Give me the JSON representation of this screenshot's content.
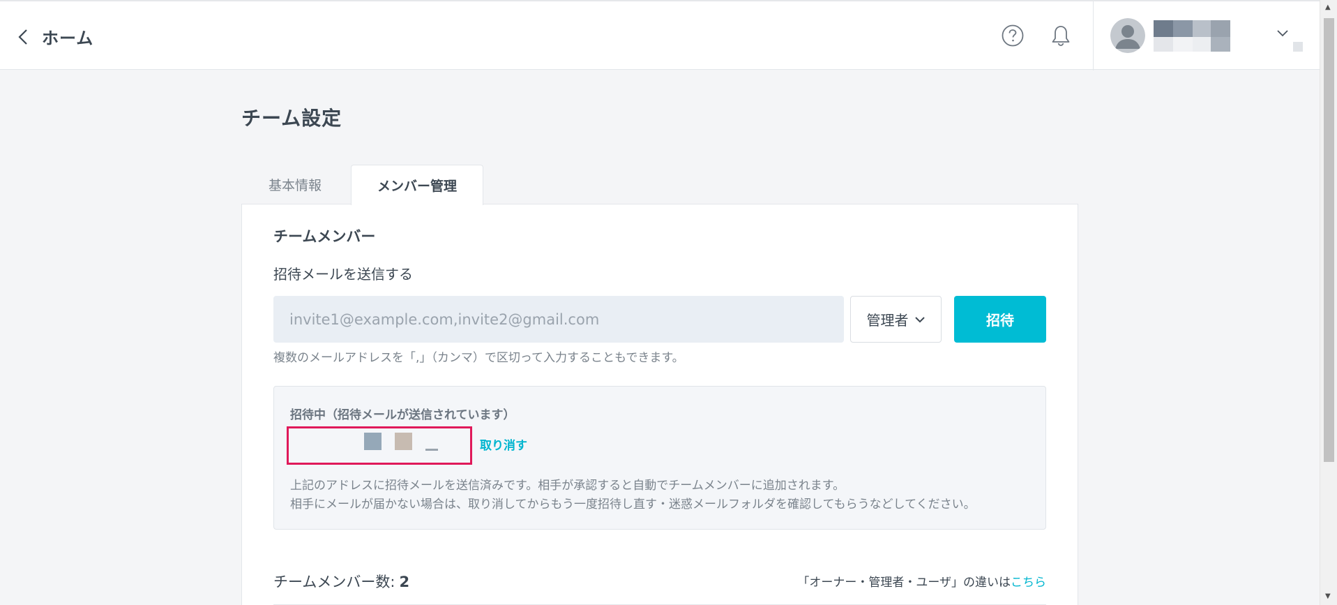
{
  "header": {
    "back_label": "ホーム",
    "icons": [
      "chevron-left-icon",
      "help-icon",
      "bell-icon",
      "chevron-down-icon"
    ]
  },
  "page": {
    "title": "チーム設定"
  },
  "tabs": [
    {
      "label": "基本情報",
      "active": false
    },
    {
      "label": "メンバー管理",
      "active": true
    }
  ],
  "members_section": {
    "title": "チームメンバー",
    "invite_label": "招待メールを送信する",
    "email_placeholder": "invite1@example.com,invite2@gmail.com",
    "role_selected": "管理者",
    "invite_button": "招待",
    "help_text": "複数のメールアドレスを「,」（カンマ）で区切って入力することもできます。"
  },
  "pending": {
    "title": "招待中（招待メールが送信されています）",
    "cancel_label": "取り消す",
    "note_line1": "上記のアドレスに招待メールを送信済みです。相手が承認すると自動でチームメンバーに追加されます。",
    "note_line2": "相手にメールが届かない場合は、取り消してからもう一度招待し直す・迷惑メールフォルダを確認してもらうなどしてください。"
  },
  "member_count": {
    "label": "チームメンバー数:",
    "value": "2"
  },
  "role_difference": {
    "text": "「オーナー・管理者・ユーザ」の違いは",
    "link": "こちら"
  },
  "colors": {
    "accent": "#00bcd4",
    "link": "#00b5cf",
    "highlight_border": "#e0195a"
  }
}
